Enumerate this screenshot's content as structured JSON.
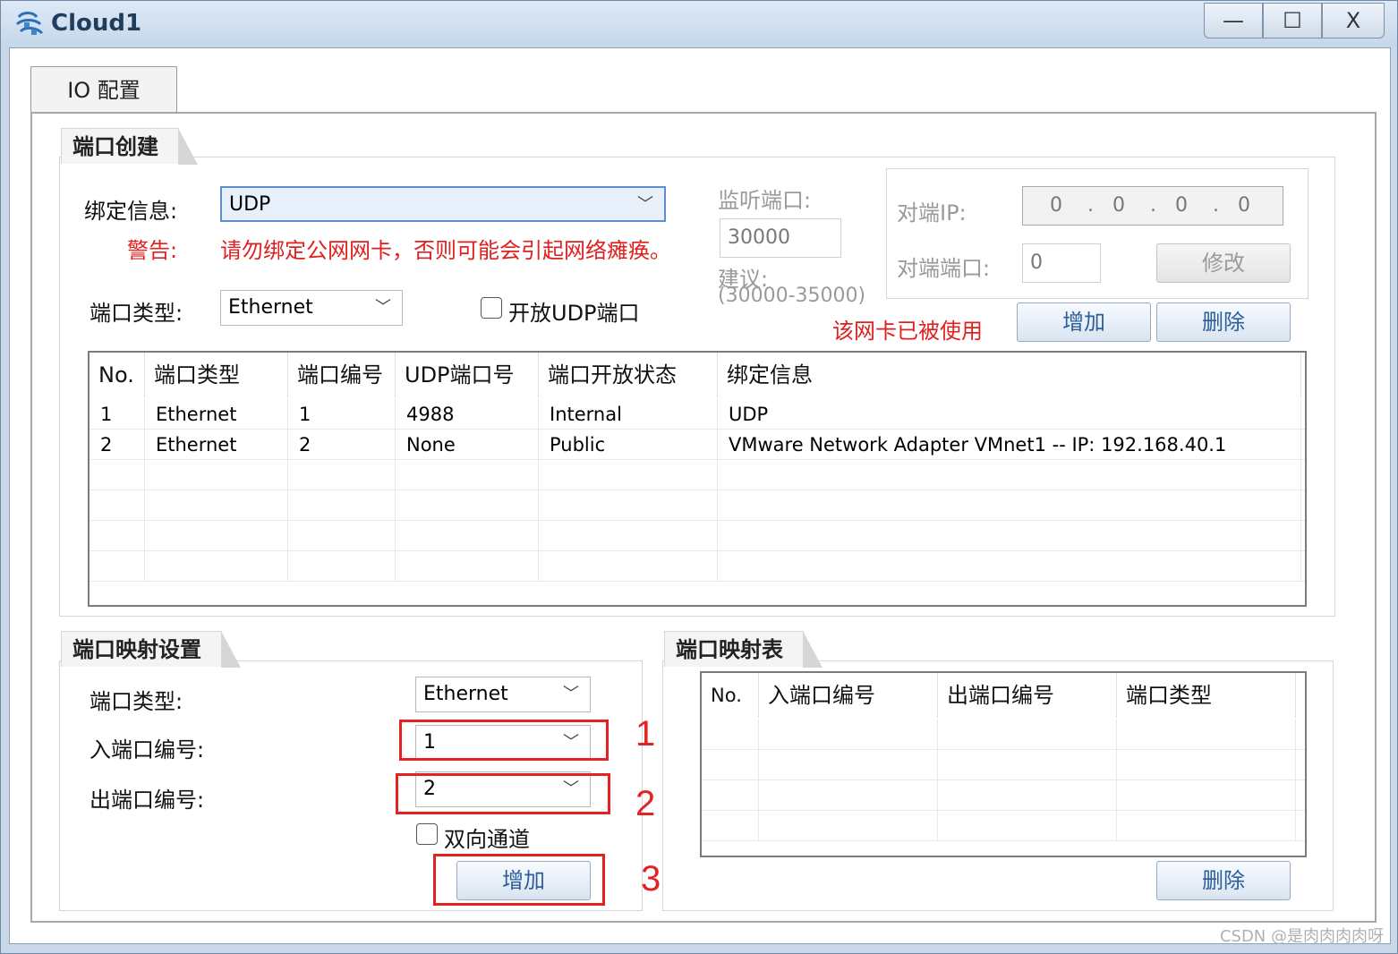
{
  "window": {
    "title": "Cloud1",
    "minimize_label": "—",
    "maximize_label": "☐",
    "close_label": "X"
  },
  "tab": {
    "label": "IO 配置"
  },
  "port_create": {
    "title": "端口创建",
    "bind_label": "绑定信息:",
    "bind_value": "UDP",
    "warning_label": "警告:",
    "warning_text": "请勿绑定公网网卡，否则可能会引起网络瘫痪。",
    "port_type_label": "端口类型:",
    "port_type_value": "Ethernet",
    "open_udp_label": "开放UDP端口",
    "listen_label": "监听端口:",
    "listen_value": "30000",
    "suggest_label": "建议:",
    "suggest_range": "(30000-35000)",
    "peer_ip_label": "对端IP:",
    "peer_ip_octets": [
      "0",
      "0",
      "0",
      "0"
    ],
    "peer_port_label": "对端端口:",
    "peer_port_value": "0",
    "modify_label": "修改",
    "in_use_text": "该网卡已被使用",
    "add_label": "增加",
    "delete_label": "删除",
    "table": {
      "headers": [
        "No.",
        "端口类型",
        "端口编号",
        "UDP端口号",
        "端口开放状态",
        "绑定信息"
      ],
      "rows": [
        [
          "1",
          "Ethernet",
          "1",
          "4988",
          "Internal",
          "UDP"
        ],
        [
          "2",
          "Ethernet",
          "2",
          "None",
          "Public",
          "VMware Network Adapter VMnet1 -- IP: 192.168.40.1"
        ]
      ]
    }
  },
  "mapping_settings": {
    "title": "端口映射设置",
    "port_type_label": "端口类型:",
    "port_type_value": "Ethernet",
    "in_port_label": "入端口编号:",
    "in_port_value": "1",
    "out_port_label": "出端口编号:",
    "out_port_value": "2",
    "bidirectional_label": "双向通道",
    "add_label": "增加"
  },
  "mapping_table": {
    "title": "端口映射表",
    "headers": [
      "No.",
      "入端口编号",
      "出端口编号",
      "端口类型"
    ],
    "delete_label": "删除"
  },
  "annotations": [
    "1",
    "2",
    "3"
  ],
  "watermark": "CSDN @是肉肉肉肉呀",
  "colors": {
    "warning": "#e02020",
    "annotation": "#e32222",
    "button_text": "#2b5d9a"
  }
}
